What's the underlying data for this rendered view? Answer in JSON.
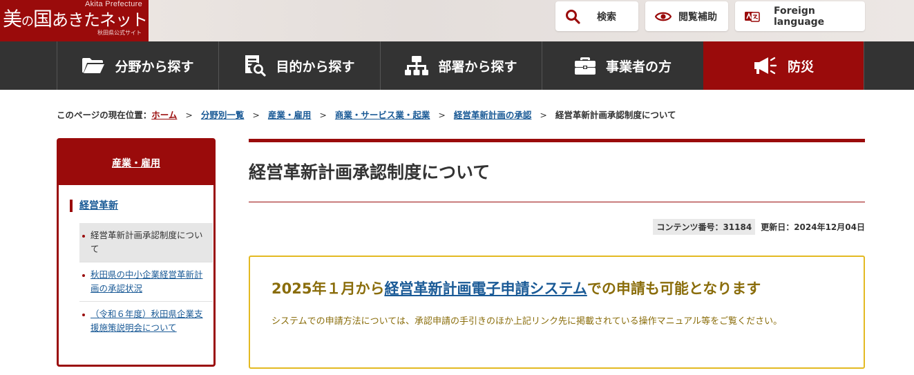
{
  "header": {
    "logo": {
      "sub": "Akita Prefecture",
      "main_kanji": "美",
      "main_no": "の",
      "main_kuni": "国",
      "main_rest": "あきたネット",
      "caption": "秋田県公式サイト"
    },
    "search_label": "検索",
    "assist_label": "閲覧補助",
    "lang_label": "Foreign language"
  },
  "nav": {
    "items": [
      {
        "label": "分野から探す",
        "icon": "folder-icon"
      },
      {
        "label": "目的から探す",
        "icon": "document-search-icon"
      },
      {
        "label": "部署から探す",
        "icon": "org-chart-icon"
      },
      {
        "label": "事業者の方",
        "icon": "briefcase-icon"
      },
      {
        "label": "防災",
        "icon": "megaphone-icon"
      }
    ]
  },
  "breadcrumb": {
    "prefix": "このページの現在位置：",
    "items": [
      "ホーム",
      "分野別一覧",
      "産業・雇用",
      "商業・サービス業・起業",
      "経営革新計画の承認"
    ],
    "current": "経営革新計画承認制度について",
    "separator": ">"
  },
  "side": {
    "heading": "産業・雇用",
    "category": "経営革新",
    "items": [
      {
        "label": "経営革新計画承認制度について",
        "active": true
      },
      {
        "label": "秋田県の中小企業経営革新計画の承認状況",
        "active": false
      },
      {
        "label": "（令和６年度）秋田県企業支援施策説明会について",
        "active": false
      }
    ]
  },
  "main": {
    "title": "経営革新計画承認制度について",
    "content_no": "コンテンツ番号：31184",
    "updated": "更新日：2024年12月04日",
    "notice": {
      "heading_before": "2025年１月から",
      "heading_link": "経営革新計画電子申請システム",
      "heading_after": "での申請も可能となります",
      "body": "システムでの申請方法については、承認申請の手引きのほか上記リンク先に掲載されている操作マニュアル等をご覧ください。"
    }
  },
  "colors": {
    "brand": "#9a0b0b",
    "nav_bg": "#333333",
    "link": "#1a5a96",
    "notice_border": "#e3b921",
    "notice_text": "#8a6d0b"
  }
}
